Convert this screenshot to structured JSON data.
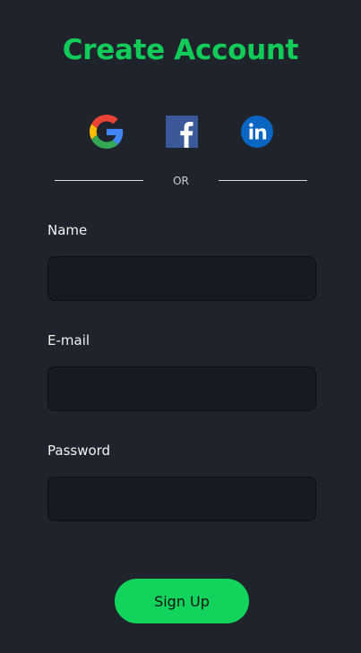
{
  "form": {
    "title": "Create Account",
    "divider_text": "OR",
    "socials": [
      {
        "name": "Google",
        "icon": "google-icon"
      },
      {
        "name": "Facebook",
        "icon": "facebook-icon",
        "color": "#3b5998"
      },
      {
        "name": "LinkedIn",
        "icon": "linkedin-icon",
        "color": "#0a66c2"
      }
    ],
    "fields": {
      "name": {
        "label": "Name",
        "value": "",
        "placeholder": ""
      },
      "email": {
        "label": "E-mail",
        "value": "",
        "placeholder": ""
      },
      "password": {
        "label": "Password",
        "value": "",
        "placeholder": ""
      }
    },
    "submit_label": "Sign Up"
  },
  "colors": {
    "background": "#1f232b",
    "accent": "#12cc5a",
    "input_bg": "#171a22"
  }
}
